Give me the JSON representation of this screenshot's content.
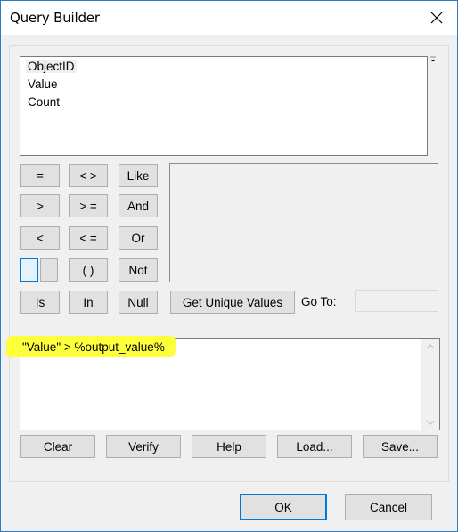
{
  "window": {
    "title": "Query Builder",
    "close_icon": "close-icon"
  },
  "fields": {
    "items": [
      {
        "label": "ObjectID",
        "selected": true
      },
      {
        "label": "Value",
        "selected": false
      },
      {
        "label": "Count",
        "selected": false
      }
    ]
  },
  "operators": {
    "equals": "=",
    "not_equals": "< >",
    "like": "Like",
    "greater": ">",
    "greater_equal": "> =",
    "and": "And",
    "less": "<",
    "less_equal": "< =",
    "or": "Or",
    "parentheses": "( )",
    "not": "Not",
    "is": "Is",
    "in": "In",
    "null": "Null"
  },
  "unique_values": {
    "get_button": "Get Unique Values",
    "goto_label": "Go To:",
    "goto_value": ""
  },
  "expression": {
    "text": "\"Value\" > %output_value%",
    "highlight_color": "#fdff3c"
  },
  "actions": {
    "clear": "Clear",
    "verify": "Verify",
    "help": "Help",
    "load": "Load...",
    "save": "Save..."
  },
  "dialog": {
    "ok": "OK",
    "cancel": "Cancel"
  },
  "colors": {
    "accent": "#0078d7",
    "window_border": "#2b7bc4",
    "button_face": "#e1e1e1",
    "dialog_bg": "#f0f0f0"
  }
}
